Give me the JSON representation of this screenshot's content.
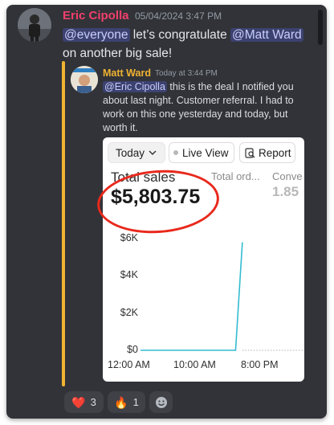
{
  "message": {
    "author": "Eric Cipolla",
    "timestamp": "05/04/2024 3:47 PM",
    "mention_1": "@everyone",
    "text_1": " let’s congratulate ",
    "mention_2": "@Matt Ward",
    "text_2": " on another big sale!"
  },
  "quote": {
    "author": "Matt Ward",
    "timestamp": "Today at 3:44 PM",
    "mention": "@Eric Cipolla",
    "text": " this is the deal I notified you about last night. Customer referral. I had to work on this one yesterday and today, but worth it."
  },
  "embed": {
    "date_range": "Today",
    "chevron_icon": "chevron-down-icon",
    "live_view": "Live View",
    "report": "Report",
    "report_icon": "report-search-icon",
    "metric_label": "Total sales",
    "metric_value": "$5,803.75",
    "orders_label": "Total ord...",
    "conversion_label": "Conve",
    "conversion_value": "1.85",
    "highlight_color": "#e8291c"
  },
  "chart_data": {
    "type": "line",
    "title": "",
    "xlabel": "",
    "ylabel": "",
    "x_ticks": [
      "12:00 AM",
      "10:00 AM",
      "8:00 PM"
    ],
    "y_ticks": [
      "$0",
      "$2K",
      "$4K",
      "$6K"
    ],
    "ylim": [
      0,
      6000
    ],
    "xlim": [
      0,
      24
    ],
    "series": [
      {
        "color": "#33bbd1",
        "x": [
          0,
          1,
          2,
          3,
          4,
          5,
          6,
          7,
          8,
          9,
          10,
          11,
          12,
          13,
          14,
          15
        ],
        "y": [
          0,
          0,
          0,
          0,
          0,
          0,
          0,
          0,
          0,
          0,
          0,
          0,
          0,
          0,
          0,
          5803.75
        ]
      }
    ],
    "grid": false
  },
  "reactions": [
    {
      "emoji": "❤️",
      "count": "3"
    },
    {
      "emoji": "🔥",
      "count": "1"
    },
    {
      "emoji": "add-reaction-icon",
      "count": ""
    }
  ],
  "colors": {
    "background": "#313338",
    "author_eric": "#f23f6b",
    "author_matt": "#f0b232",
    "mention_bg": "#3c4270",
    "line": "#33bbd1"
  }
}
